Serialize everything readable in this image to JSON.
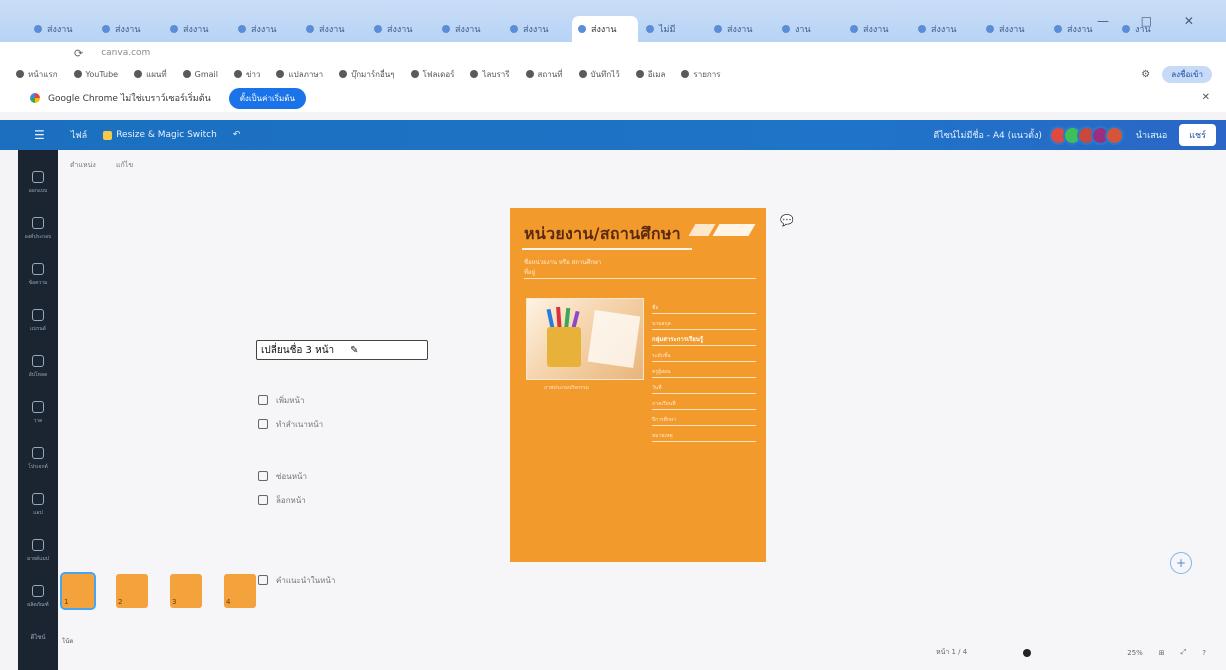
{
  "browser": {
    "tabs": [
      "ส่งงาน",
      "ส่งงาน",
      "ส่งงาน",
      "ส่งงาน",
      "ส่งงาน",
      "ส่งงาน",
      "ส่งงาน",
      "ส่งงาน",
      "ส่งงาน",
      "ไม่มี",
      "ส่งงาน",
      "งาน",
      "ส่งงาน",
      "ส่งงาน",
      "ส่งงาน",
      "ส่งงาน",
      "งาน"
    ],
    "active_tab_index": 8,
    "window_controls": "— □ ✕",
    "address": "canva.com",
    "signin_label": "ลงชื่อเข้า",
    "bookmarks": [
      "หน้าแรก",
      "YouTube",
      "แผนที่",
      "Gmail",
      "ข่าว",
      "แปลภาษา",
      "บุ๊กมาร์กอื่นๆ",
      "โฟลเดอร์",
      "ไลบรารี",
      "สถานที่",
      "บันทึกไว้",
      "อีเมล",
      "รายการ"
    ]
  },
  "promo": {
    "text": "Google Chrome ไม่ใช่เบราว์เซอร์เริ่มต้น",
    "cta": "ตั้งเป็นค่าเริ่มต้น",
    "close": "✕"
  },
  "editor_header": {
    "menu_icon": "☰",
    "file_label": "ไฟล์",
    "resize_label": "Resize & Magic Switch",
    "undo_icon": "↶",
    "title": "ดีไซน์ไม่มีชื่อ - A4 (แนวตั้ง)",
    "present_label": "นำเสนอ",
    "share_label": "แชร์",
    "avatar_colors": [
      "#e0493f",
      "#3fbf5a",
      "#c9473b",
      "#9a2f80",
      "#d6553a"
    ]
  },
  "rail": {
    "items": [
      "ออกแบบ",
      "องค์ประกอบ",
      "ข้อความ",
      "แบรนด์",
      "อัปโหลด",
      "วาด",
      "โปรเจกต์",
      "แอป",
      "มายด์แมป",
      "ผลิตภัณฑ์"
    ],
    "bottom_label": "ดีไซน์"
  },
  "workspace": {
    "mini_toolbar": [
      "ตำแหน่ง",
      "แก้ไข"
    ],
    "context_panel": {
      "title": "เปลี่ยนชื่อ 3 หน้า",
      "actions_group1": [
        "เพิ่มหน้า",
        "ทำสำเนาหน้า"
      ],
      "actions_group2": [
        "ซ่อนหน้า",
        "ล็อกหน้า"
      ],
      "footer": "คำแนะนำในหน้า"
    },
    "comment_icon": "💬"
  },
  "page": {
    "heading": "หน่วยงาน/สถานศึกษา",
    "sub_lines": [
      "ชื่อหน่วยงาน หรือ สถานศึกษา",
      "ที่อยู่"
    ],
    "photo_caption": "ภาพประกอบกิจกรรม",
    "details": [
      {
        "text": "ชื่อ",
        "highlight": false
      },
      {
        "text": "นามสกุล",
        "highlight": false
      },
      {
        "text": "กลุ่มสาระการเรียนรู้",
        "highlight": true
      },
      {
        "text": "ระดับชั้น",
        "highlight": false
      },
      {
        "text": "ครูผู้สอน",
        "highlight": false
      },
      {
        "text": "วันที่",
        "highlight": false
      },
      {
        "text": "ภาคเรียนที่",
        "highlight": false
      },
      {
        "text": "ปีการศึกษา",
        "highlight": false
      },
      {
        "text": "หมายเหตุ",
        "highlight": false
      }
    ]
  },
  "thumbnails": [
    "1",
    "2",
    "3",
    "4"
  ],
  "notes_label": "โน้ต",
  "status": {
    "pages_label": "หน้า 1 / 4",
    "zoom_label": "25%",
    "grid_icon": "⊞",
    "fullscreen_icon": "⤢",
    "help_icon": "?"
  },
  "fab_icon": "+"
}
